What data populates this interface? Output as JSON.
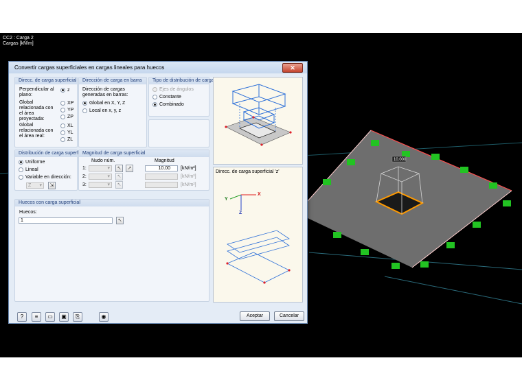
{
  "viewport": {
    "info_line1": "CC2 : Carga 2",
    "info_line2": "Cargas [kN/m]",
    "load_label": "10.000"
  },
  "dialog": {
    "title": "Convertir cargas superficiales en cargas lineales para huecos",
    "close_label": "✕",
    "direction_group": {
      "title": "Direcc. de carga superficial",
      "perpendicular_label": "Perpendicular al plano:",
      "perpendicular_option": "z",
      "global_projected_label": "Global relacionada con el área proyectada:",
      "global_projected_options": [
        "XP",
        "YP",
        "ZP"
      ],
      "global_real_label": "Global relacionada con el área real:",
      "global_real_options": [
        "XL",
        "YL",
        "ZL"
      ]
    },
    "bar_direction_group": {
      "title": "Dirección de carga en barra",
      "description": "Dirección de cargas generadas en barras:",
      "options": [
        "Global en X, Y, Z",
        "Local en x, y, z"
      ]
    },
    "distribution_type_group": {
      "title": "Tipo de distribución de carga",
      "options": [
        "Ejes de ángulos",
        "Constante",
        "Combinado"
      ]
    },
    "surface_distribution_group": {
      "title": "Distribución de carga superf.",
      "options": [
        "Uniforme",
        "Lineal",
        "Variable en dirección:"
      ],
      "direction_value": "Z"
    },
    "magnitude_group": {
      "title": "Magnitud de carga superficial",
      "node_header": "Nudo núm.",
      "magnitude_header": "Magnitud",
      "rows": [
        {
          "index": "1:",
          "node": "",
          "magnitude": "10.00",
          "unit": "[kN/m²]"
        },
        {
          "index": "2:",
          "node": "",
          "magnitude": "",
          "unit": "[kN/m²]"
        },
        {
          "index": "3:",
          "node": "",
          "magnitude": "",
          "unit": "[kN/m²]"
        }
      ]
    },
    "openings_group": {
      "title": "Huecos con carga superficial",
      "openings_label": "Huecos:",
      "openings_value": "1"
    },
    "preview_caption": "Direcc. de carga superficial 'z'",
    "axis_labels": {
      "y": "Y",
      "x": "X",
      "z": "Z"
    },
    "buttons": {
      "accept": "Aceptar",
      "cancel": "Cancelar"
    }
  }
}
